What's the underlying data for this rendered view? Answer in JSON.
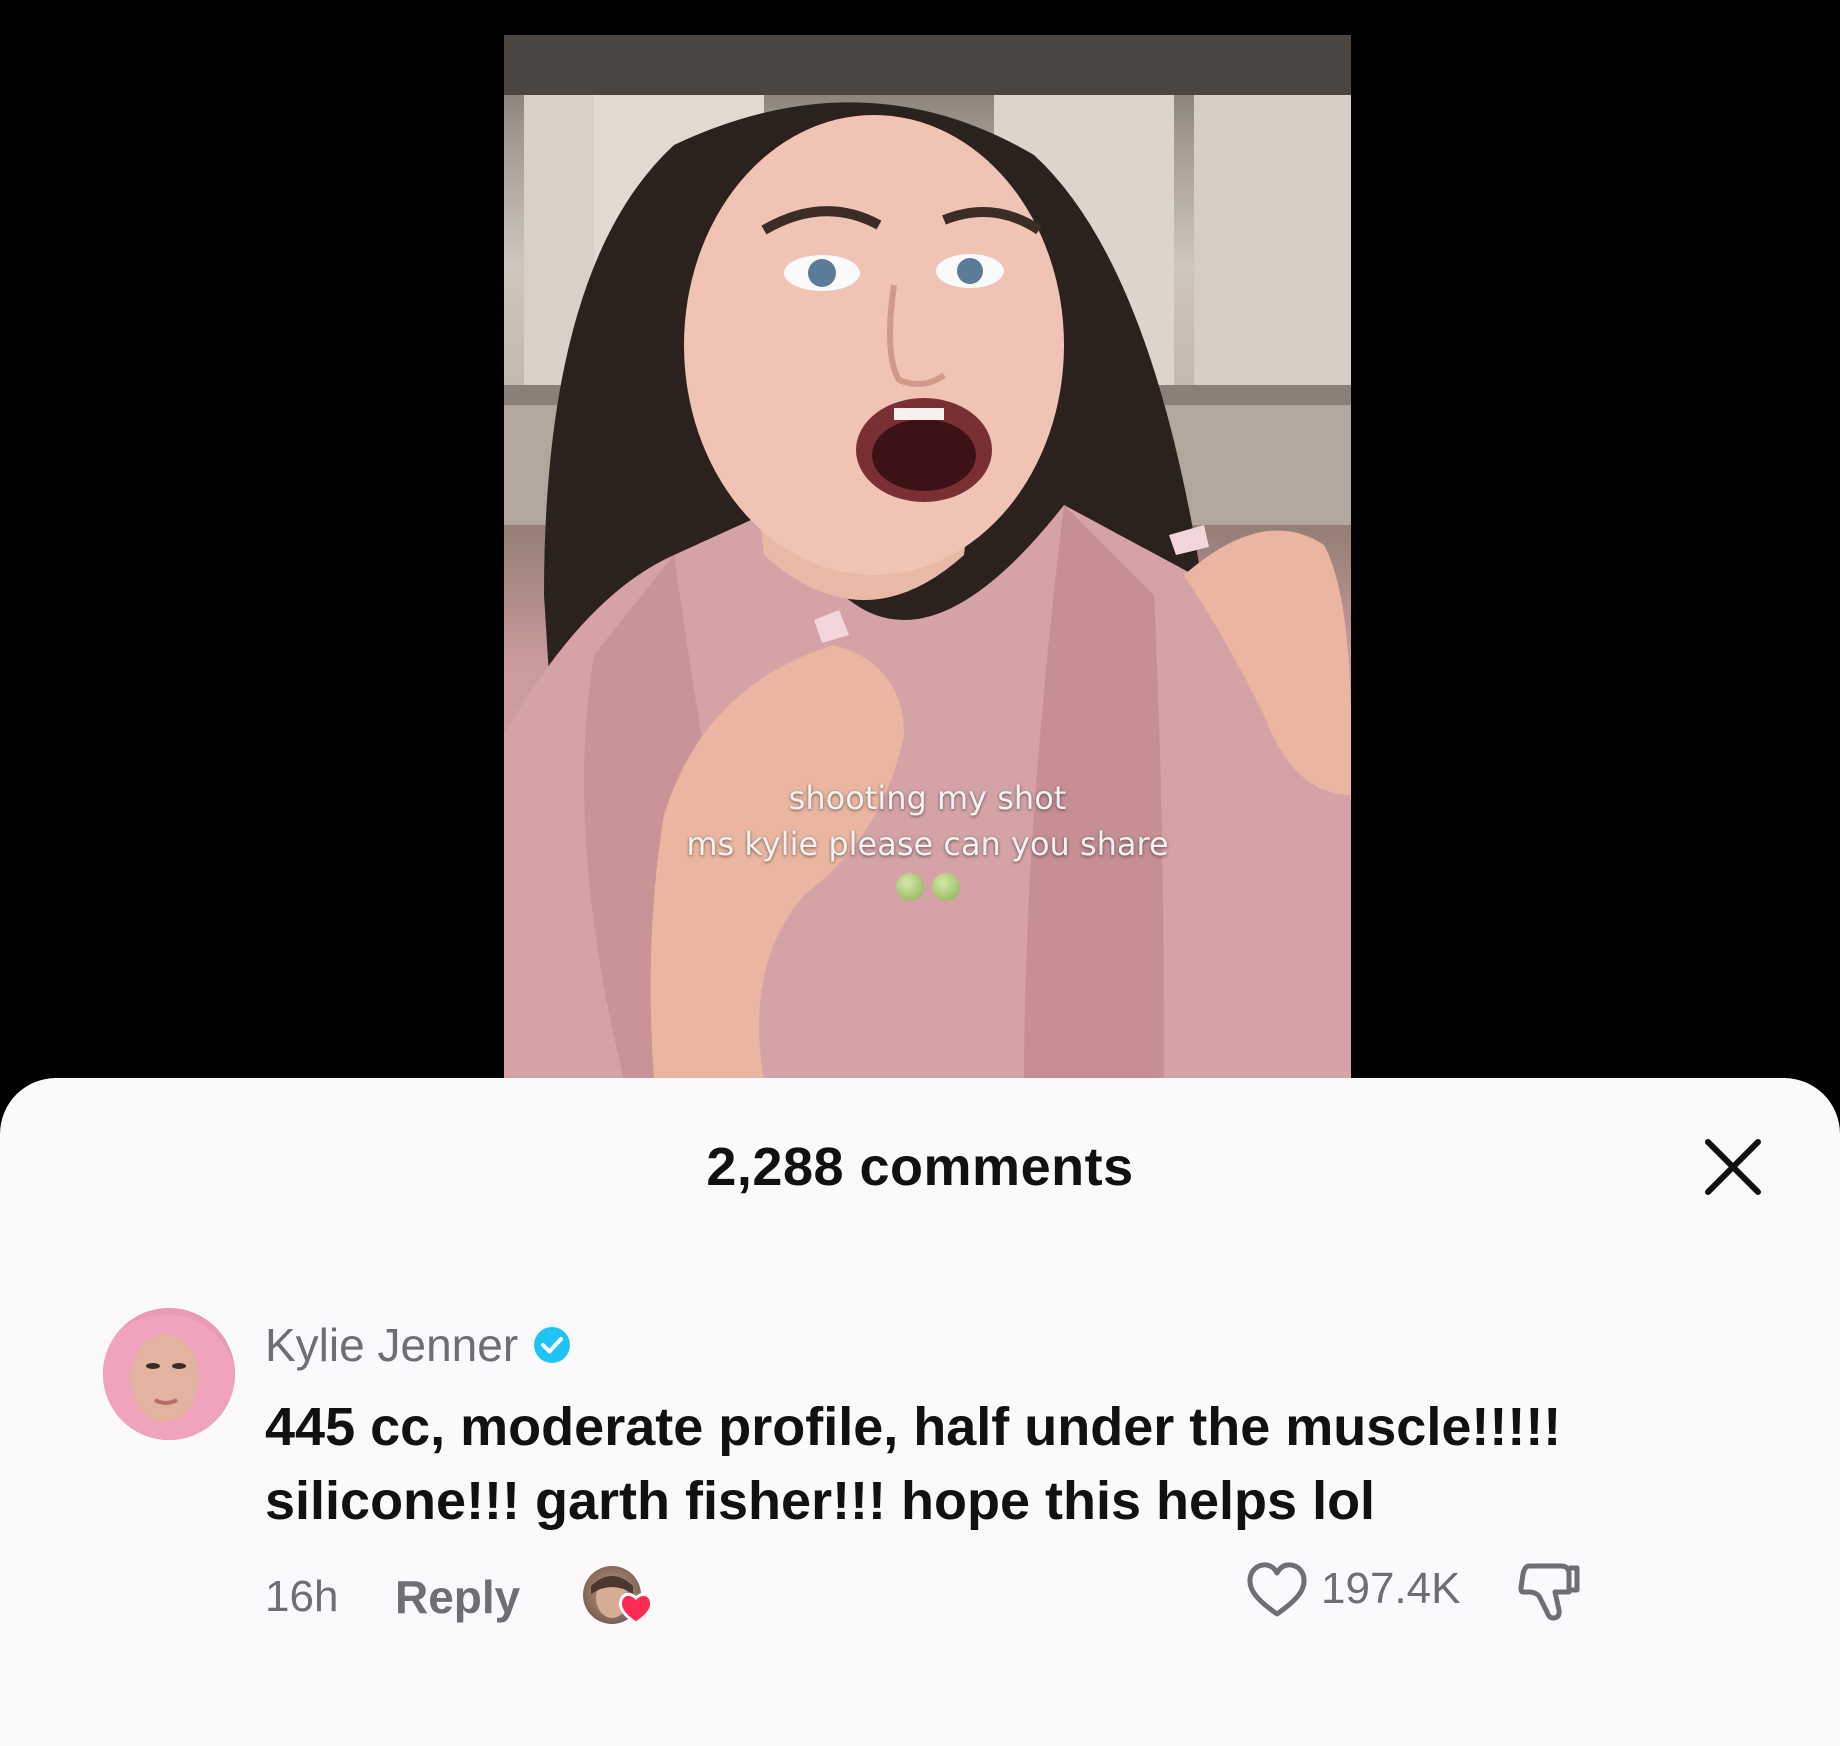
{
  "video": {
    "caption_line1": "shooting my shot",
    "caption_line2": "ms kylie please can you share"
  },
  "comments_sheet": {
    "title": "2,288 comments",
    "close_icon": "close-icon"
  },
  "comment": {
    "author": "Kylie Jenner",
    "verified": true,
    "text_line1": "445 cc, moderate profile, half under the muscle!!!!!",
    "text_line2": "silicone!!! garth fisher!!! hope this helps lol",
    "time": "16h",
    "reply_label": "Reply",
    "liked_by_creator": true,
    "like_count": "197.4K"
  },
  "colors": {
    "sheet_background": "#fbf9fc",
    "verified_blue": "#20c4f4",
    "heart_red": "#fe2c55",
    "secondary_text": "#6e6e73"
  }
}
